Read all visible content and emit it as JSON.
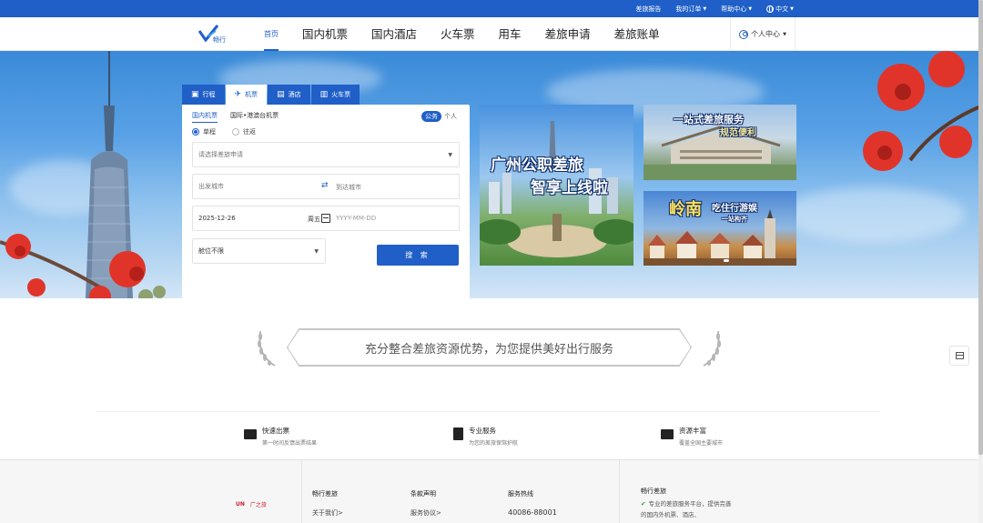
{
  "topbar": {
    "links": [
      {
        "label": "差旅报告",
        "has_caret": false
      },
      {
        "label": "我的订单",
        "has_caret": true
      },
      {
        "label": "帮助中心",
        "has_caret": true
      },
      {
        "label": "中文",
        "has_caret": true,
        "icon": "globe-icon"
      }
    ],
    "background": "#1f5fc7"
  },
  "nav": {
    "logo_text": "畅行",
    "items": [
      {
        "label": "首页",
        "active": true
      },
      {
        "label": "国内机票"
      },
      {
        "label": "国内酒店"
      },
      {
        "label": "火车票"
      },
      {
        "label": "用车"
      },
      {
        "label": "差旅申请"
      },
      {
        "label": "差旅账单"
      }
    ],
    "personal_center": "个人中心"
  },
  "search": {
    "tabs": [
      {
        "label": "行程",
        "icon": "briefcase-icon"
      },
      {
        "label": "机票",
        "icon": "plane-icon",
        "active": true
      },
      {
        "label": "酒店",
        "icon": "hotel-icon"
      },
      {
        "label": "火车票",
        "icon": "train-icon"
      }
    ],
    "subtabs": [
      "国内机票",
      "国际•港澳台机票"
    ],
    "public_label": "公务",
    "private_label": "个人",
    "trip_types": [
      {
        "label": "单程",
        "selected": true
      },
      {
        "label": "往返",
        "selected": false
      }
    ],
    "application_placeholder": "请选择差旅申请",
    "from_placeholder": "出发城市",
    "to_placeholder": "到达城市",
    "depart_date": "2025-12-26",
    "depart_weekday": "周五",
    "return_placeholder": "YYYY-MM-DD",
    "cabin": "舱位不限",
    "search_button": "搜 索"
  },
  "banners": {
    "main_line1": "广州公职差旅",
    "main_line2": "智享上线啦",
    "top_right": "一站式差旅服务",
    "top_right_sub": "规范便利",
    "bottom_right_big": "岭南",
    "bottom_right": "吃住行游娱",
    "bottom_right_sub": "一站构齐"
  },
  "slogan": "充分整合差旅资源优势，为您提供美好出行服务",
  "features": [
    {
      "title": "快速出票",
      "desc": "第一时间反馈出票结果",
      "icon": "ticket-icon"
    },
    {
      "title": "专业服务",
      "desc": "为您的差旅保驾护航",
      "icon": "document-icon"
    },
    {
      "title": "资源丰富",
      "desc": "覆盖全国主要城市",
      "icon": "wallet-icon"
    }
  ],
  "footer": {
    "col1_title": "畅行差旅",
    "col1_link": "关于我们>",
    "col2_title": "条款声明",
    "col2_link": "服务协议>",
    "col3_title": "服务热线",
    "col3_value": "40086-88001",
    "col4_title": "畅行差旅",
    "col4_desc": "专业的差旅服务平台，提供完善的国内外机票、酒店、",
    "logo_left": "UN",
    "logo_right": "广之旅"
  }
}
